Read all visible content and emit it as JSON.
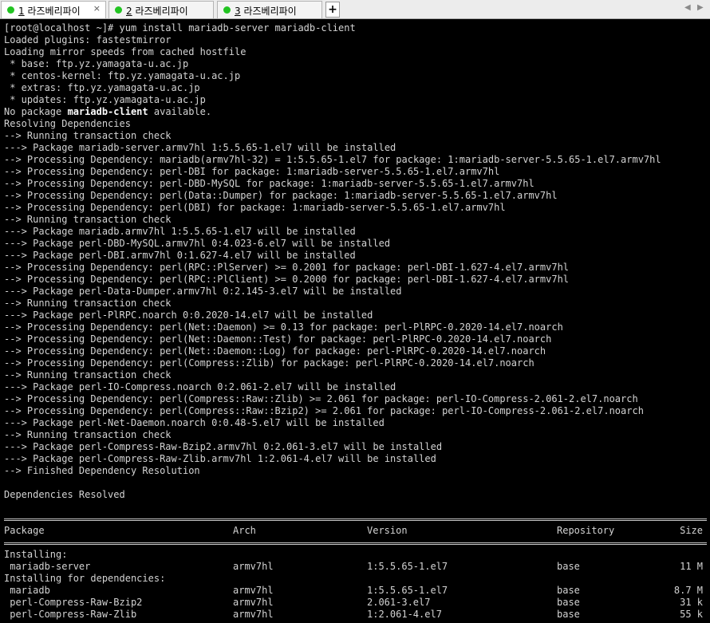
{
  "tabs": [
    {
      "num": "1",
      "name": " 라즈베리파이",
      "status_color": "#22c422",
      "active": true
    },
    {
      "num": "2",
      "name": " 라즈베리파이",
      "status_color": "#22c422",
      "active": false
    },
    {
      "num": "3",
      "name": " 라즈베리파이",
      "status_color": "#22c422",
      "active": false
    }
  ],
  "tab_close_glyph": "×",
  "add_tab_glyph": "+",
  "nav": {
    "prev": "◀",
    "next": "▶"
  },
  "terminal": {
    "prompt": "[root@localhost ~]# yum install mariadb-server mariadb-client",
    "lines_top": [
      "Loaded plugins: fastestmirror",
      "Loading mirror speeds from cached hostfile",
      " * base: ftp.yz.yamagata-u.ac.jp",
      " * centos-kernel: ftp.yz.yamagata-u.ac.jp",
      " * extras: ftp.yz.yamagata-u.ac.jp",
      " * updates: ftp.yz.yamagata-u.ac.jp"
    ],
    "nopkg": {
      "before": "No package ",
      "bold": "mariadb-client",
      "after": " available."
    },
    "lines": [
      "Resolving Dependencies",
      "--> Running transaction check",
      "---> Package mariadb-server.armv7hl 1:5.5.65-1.el7 will be installed",
      "--> Processing Dependency: mariadb(armv7hl-32) = 1:5.5.65-1.el7 for package: 1:mariadb-server-5.5.65-1.el7.armv7hl",
      "--> Processing Dependency: perl-DBI for package: 1:mariadb-server-5.5.65-1.el7.armv7hl",
      "--> Processing Dependency: perl-DBD-MySQL for package: 1:mariadb-server-5.5.65-1.el7.armv7hl",
      "--> Processing Dependency: perl(Data::Dumper) for package: 1:mariadb-server-5.5.65-1.el7.armv7hl",
      "--> Processing Dependency: perl(DBI) for package: 1:mariadb-server-5.5.65-1.el7.armv7hl",
      "--> Running transaction check",
      "---> Package mariadb.armv7hl 1:5.5.65-1.el7 will be installed",
      "---> Package perl-DBD-MySQL.armv7hl 0:4.023-6.el7 will be installed",
      "---> Package perl-DBI.armv7hl 0:1.627-4.el7 will be installed",
      "--> Processing Dependency: perl(RPC::PlServer) >= 0.2001 for package: perl-DBI-1.627-4.el7.armv7hl",
      "--> Processing Dependency: perl(RPC::PlClient) >= 0.2000 for package: perl-DBI-1.627-4.el7.armv7hl",
      "---> Package perl-Data-Dumper.armv7hl 0:2.145-3.el7 will be installed",
      "--> Running transaction check",
      "---> Package perl-PlRPC.noarch 0:0.2020-14.el7 will be installed",
      "--> Processing Dependency: perl(Net::Daemon) >= 0.13 for package: perl-PlRPC-0.2020-14.el7.noarch",
      "--> Processing Dependency: perl(Net::Daemon::Test) for package: perl-PlRPC-0.2020-14.el7.noarch",
      "--> Processing Dependency: perl(Net::Daemon::Log) for package: perl-PlRPC-0.2020-14.el7.noarch",
      "--> Processing Dependency: perl(Compress::Zlib) for package: perl-PlRPC-0.2020-14.el7.noarch",
      "--> Running transaction check",
      "---> Package perl-IO-Compress.noarch 0:2.061-2.el7 will be installed",
      "--> Processing Dependency: perl(Compress::Raw::Zlib) >= 2.061 for package: perl-IO-Compress-2.061-2.el7.noarch",
      "--> Processing Dependency: perl(Compress::Raw::Bzip2) >= 2.061 for package: perl-IO-Compress-2.061-2.el7.noarch",
      "---> Package perl-Net-Daemon.noarch 0:0.48-5.el7 will be installed",
      "--> Running transaction check",
      "---> Package perl-Compress-Raw-Bzip2.armv7hl 0:2.061-3.el7 will be installed",
      "---> Package perl-Compress-Raw-Zlib.armv7hl 1:2.061-4.el7 will be installed",
      "--> Finished Dependency Resolution"
    ],
    "resolved": "Dependencies Resolved",
    "table": {
      "headers": [
        "Package",
        "Arch",
        "Version",
        "Repository",
        "Size"
      ],
      "installing_label": "Installing:",
      "installing": [
        [
          "mariadb-server",
          "armv7hl",
          "1:5.5.65-1.el7",
          "base",
          "11 M"
        ]
      ],
      "deps_label": "Installing for dependencies:",
      "deps": [
        [
          "mariadb",
          "armv7hl",
          "1:5.5.65-1.el7",
          "base",
          "8.7 M"
        ],
        [
          "perl-Compress-Raw-Bzip2",
          "armv7hl",
          "2.061-3.el7",
          "base",
          "31 k"
        ],
        [
          "perl-Compress-Raw-Zlib",
          "armv7hl",
          "1:2.061-4.el7",
          "base",
          "55 k"
        ]
      ]
    }
  }
}
